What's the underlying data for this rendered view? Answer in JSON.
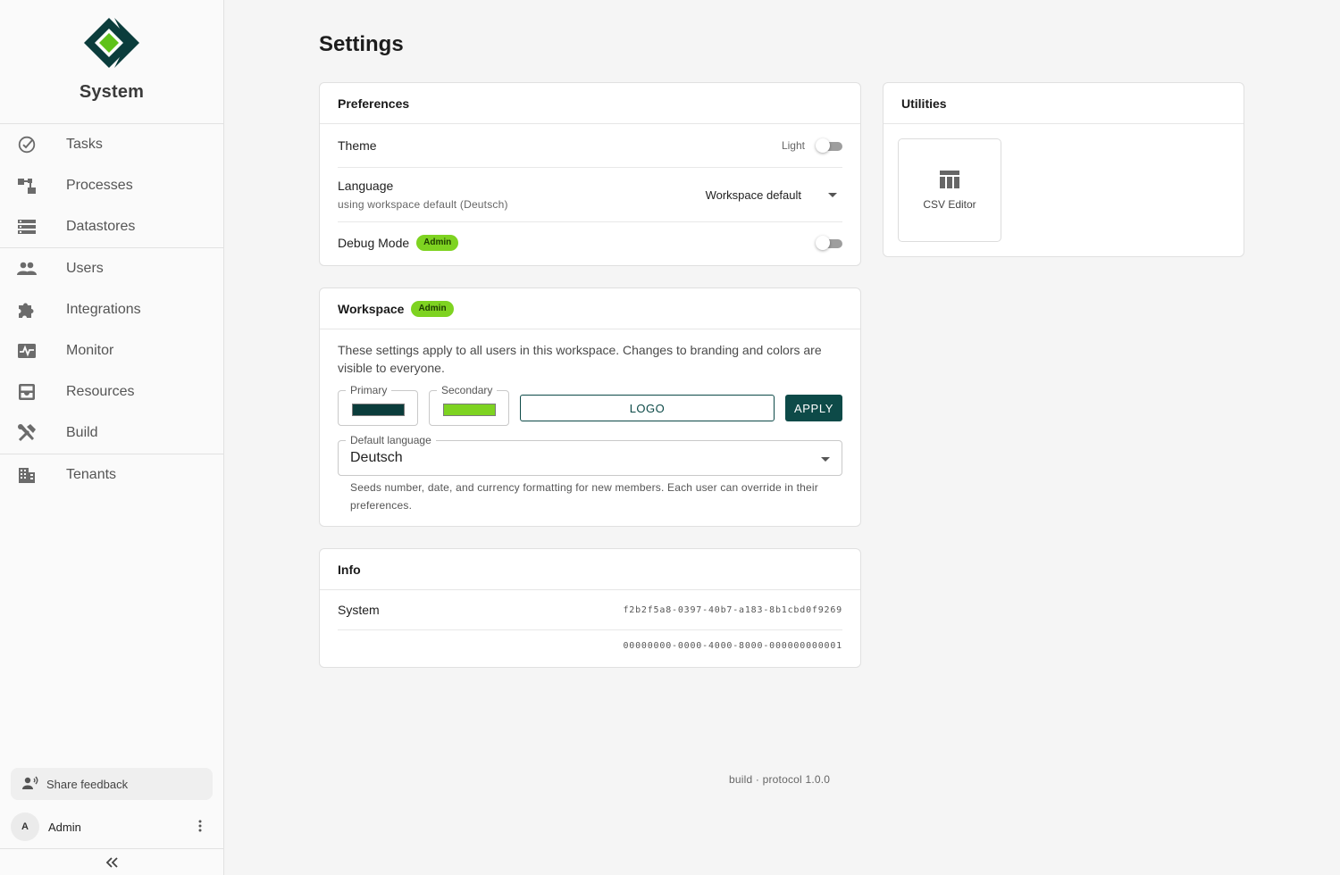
{
  "app": {
    "name": "System"
  },
  "sidebar": {
    "groups": [
      [
        {
          "label": "Tasks",
          "icon": "check-circle-icon"
        },
        {
          "label": "Processes",
          "icon": "process-icon"
        },
        {
          "label": "Datastores",
          "icon": "datastore-icon"
        }
      ],
      [
        {
          "label": "Users",
          "icon": "users-icon"
        },
        {
          "label": "Integrations",
          "icon": "puzzle-icon"
        },
        {
          "label": "Monitor",
          "icon": "monitor-icon"
        },
        {
          "label": "Resources",
          "icon": "inbox-icon"
        },
        {
          "label": "Build",
          "icon": "tools-icon"
        }
      ],
      [
        {
          "label": "Tenants",
          "icon": "building-icon"
        }
      ]
    ],
    "feedback_label": "Share feedback",
    "user": {
      "initial": "A",
      "name": "Admin"
    }
  },
  "page": {
    "title": "Settings"
  },
  "preferences": {
    "title": "Preferences",
    "theme": {
      "label": "Theme",
      "value": "Light"
    },
    "language": {
      "label": "Language",
      "sub": "using workspace default (Deutsch)",
      "value": "Workspace default"
    },
    "debug": {
      "label": "Debug Mode",
      "badge": "Admin"
    }
  },
  "workspace": {
    "title": "Workspace",
    "badge": "Admin",
    "description": "These settings apply to all users in this workspace. Changes to branding and colors are visible to everyone.",
    "primary": {
      "label": "Primary",
      "color": "#0b3d3c"
    },
    "secondary": {
      "label": "Secondary",
      "color": "#7ed321"
    },
    "logo_label": "LOGO",
    "apply_label": "APPLY",
    "default_language": {
      "label": "Default language",
      "value": "Deutsch"
    },
    "helper": "Seeds number, date, and currency formatting for new members. Each user can override in their preferences."
  },
  "info": {
    "title": "Info",
    "system_label": "System",
    "system_id": "f2b2f5a8-0397-40b7-a183-8b1cbd0f9269",
    "tenant_id": "00000000-0000-4000-8000-000000000001"
  },
  "utilities": {
    "title": "Utilities",
    "items": [
      {
        "label": "CSV Editor",
        "icon": "table-icon"
      }
    ]
  },
  "footer": {
    "text": "build · protocol 1.0.0"
  },
  "colors": {
    "accent": "#7ed321",
    "primary": "#0d4a48"
  }
}
